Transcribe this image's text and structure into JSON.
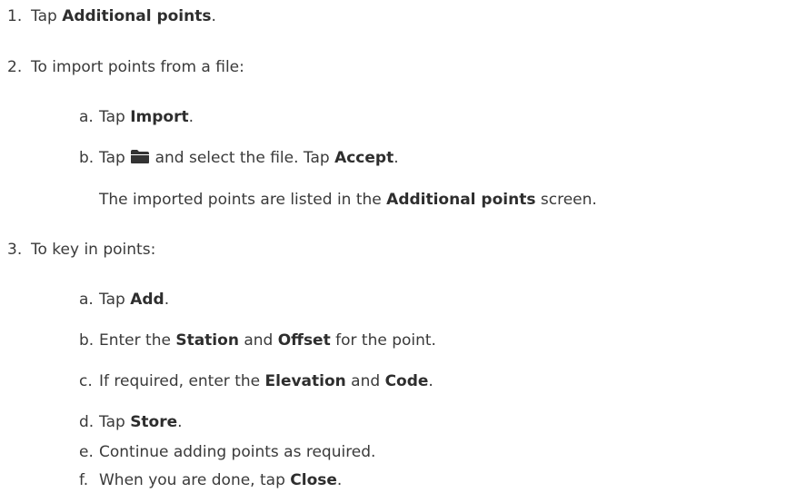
{
  "steps": [
    {
      "num": "1.",
      "pre": "Tap ",
      "bold": "Additional points",
      "post": "."
    },
    {
      "num": "2.",
      "text": "To import points from a file:"
    },
    {
      "num": "3.",
      "text": "To key in points:"
    }
  ],
  "import_substeps": [
    {
      "letter": "a.",
      "pre": "Tap ",
      "bold": "Import",
      "post": "."
    },
    {
      "letter": "b.",
      "pre": "Tap ",
      "icon": "folder-icon",
      "mid": " and select the file. Tap ",
      "bold": "Accept",
      "post": "."
    }
  ],
  "import_note": {
    "pre": "The imported points are listed in the ",
    "bold": "Additional points",
    "post": " screen."
  },
  "keyin_substeps": [
    {
      "letter": "a.",
      "pre": "Tap ",
      "bold": "Add",
      "post": "."
    },
    {
      "letter": "b.",
      "pre": "Enter the ",
      "bold": "Station",
      "mid": " and ",
      "bold2": "Offset",
      "post": " for the point."
    },
    {
      "letter": "c.",
      "pre": "If required, enter the ",
      "bold": "Elevation",
      "mid": " and ",
      "bold2": "Code",
      "post": "."
    },
    {
      "letter": "d.",
      "pre": "Tap ",
      "bold": "Store",
      "post": "."
    },
    {
      "letter": "e.",
      "text": "Continue adding points as required."
    },
    {
      "letter": "f.",
      "pre": "When you are done, tap ",
      "bold": "Close",
      "post": "."
    }
  ]
}
